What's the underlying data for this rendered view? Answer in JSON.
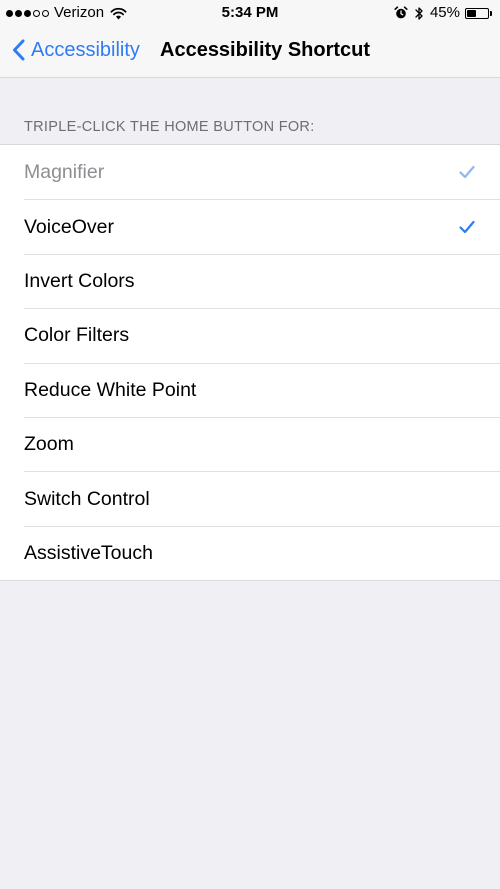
{
  "status_bar": {
    "carrier": "Verizon",
    "time": "5:34 PM",
    "battery_percent": "45%",
    "battery_level": 0.45,
    "signal_bars_filled": 3,
    "signal_bars_total": 5
  },
  "nav": {
    "back_label": "Accessibility",
    "title": "Accessibility Shortcut"
  },
  "section": {
    "header": "TRIPLE-CLICK THE HOME BUTTON FOR:"
  },
  "options": [
    {
      "label": "Magnifier",
      "checked": true,
      "enabled": false
    },
    {
      "label": "VoiceOver",
      "checked": true,
      "enabled": true
    },
    {
      "label": "Invert Colors",
      "checked": false,
      "enabled": true
    },
    {
      "label": "Color Filters",
      "checked": false,
      "enabled": true
    },
    {
      "label": "Reduce White Point",
      "checked": false,
      "enabled": true
    },
    {
      "label": "Zoom",
      "checked": false,
      "enabled": true
    },
    {
      "label": "Switch Control",
      "checked": false,
      "enabled": true
    },
    {
      "label": "AssistiveTouch",
      "checked": false,
      "enabled": true
    }
  ],
  "icons": {
    "back": "chevron-left-icon",
    "check": "checkmark-icon",
    "wifi": "wifi-icon",
    "alarm": "alarm-icon",
    "bluetooth": "bluetooth-icon",
    "battery": "battery-icon"
  },
  "colors": {
    "accent": "#2f7bf5",
    "accent_disabled": "#8fb7f2",
    "background": "#efeff4"
  }
}
